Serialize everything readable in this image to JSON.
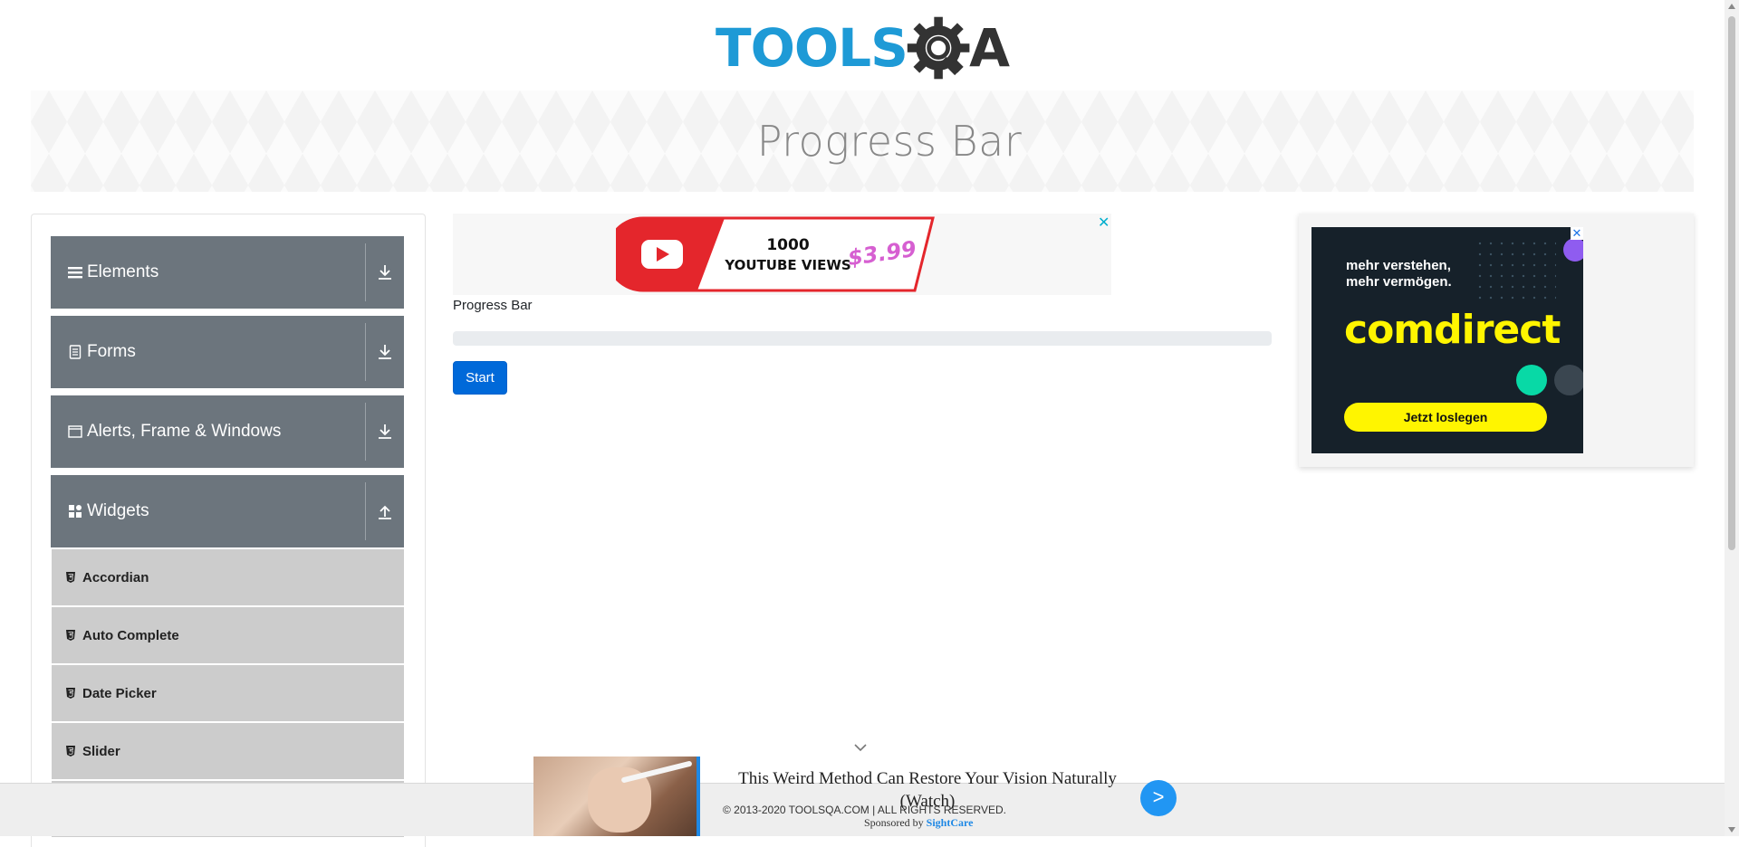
{
  "header": {
    "logo_text_a": "TOOLS",
    "logo_text_b": "A",
    "logo_icon": "gear-magnifier-icon",
    "colors": {
      "logo_blue": "#1e9ad6",
      "logo_dark": "#333333"
    }
  },
  "banner": {
    "title": "Progress Bar"
  },
  "sidebar": {
    "groups": [
      {
        "label": "Elements",
        "icon": "hamburger-icon",
        "arrow": "download-arrow-icon"
      },
      {
        "label": "Forms",
        "icon": "form-icon",
        "arrow": "download-arrow-icon"
      },
      {
        "label": "Alerts, Frame & Windows",
        "icon": "window-icon",
        "arrow": "download-arrow-icon"
      },
      {
        "label": "Widgets",
        "icon": "widgets-icon",
        "arrow": "upload-arrow-icon"
      }
    ],
    "items": [
      {
        "label": "Accordian",
        "icon": "html5-icon"
      },
      {
        "label": "Auto Complete",
        "icon": "html5-icon"
      },
      {
        "label": "Date Picker",
        "icon": "html5-icon"
      },
      {
        "label": "Slider",
        "icon": "html5-icon"
      }
    ],
    "colors": {
      "group_bg": "#6c757d",
      "item_bg": "#cccccc"
    }
  },
  "main": {
    "ad_top": {
      "count": "1000",
      "line2": "YOUTUBE VIEWS",
      "price": "$3.99",
      "close": "✕"
    },
    "progress_label": "Progress Bar",
    "progress_value": 0,
    "start_button": "Start",
    "colors": {
      "button_bg": "#0069d9",
      "progress_track": "#e9ecef"
    }
  },
  "right_ad": {
    "tagline": "mehr verstehen,\nmehr vermögen.",
    "brand": "comdirect",
    "cta": "Jetzt loslegen",
    "close": "✕",
    "colors": {
      "bg": "#16212a",
      "brand": "#fff500"
    }
  },
  "bottom_ad": {
    "headline": "This Weird Method Can Restore Your Vision Naturally (Watch)",
    "sponsored_prefix": "Sponsored by",
    "sponsor": "SightCare",
    "go": ">"
  },
  "footer": {
    "text": "© 2013-2020 TOOLSQA.COM | ALL RIGHTS RESERVED."
  }
}
